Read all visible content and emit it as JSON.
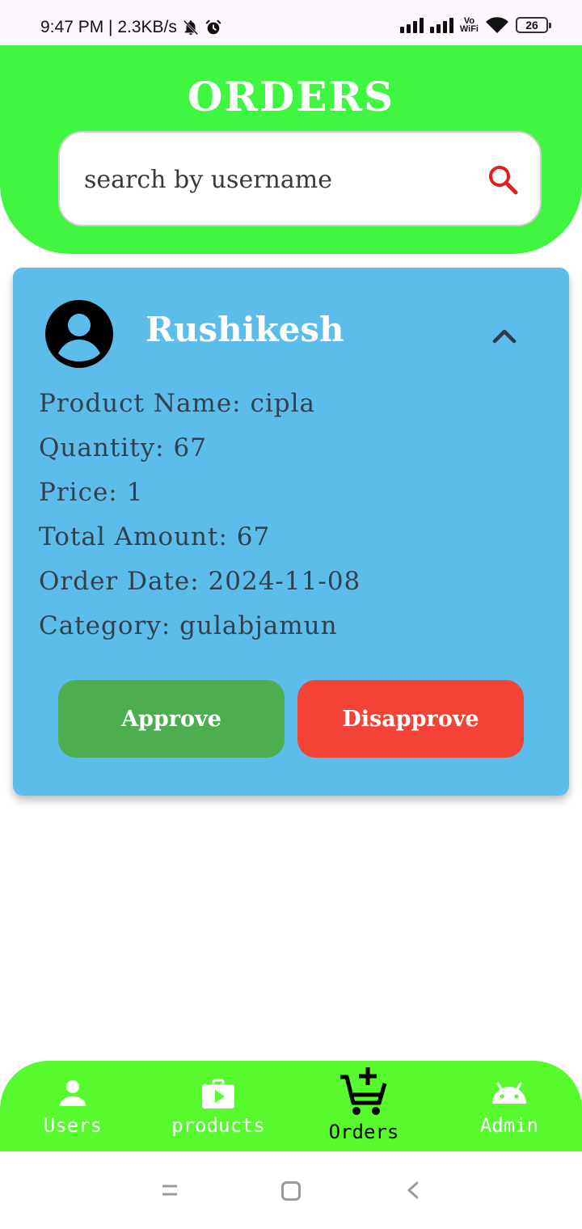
{
  "status_bar": {
    "time_network": "9:47 PM | 2.3KB/s",
    "vowifi_top": "Vo",
    "vowifi_bottom": "WiFi",
    "battery": "26"
  },
  "header": {
    "title": "ORDERS",
    "search_placeholder": "search by username"
  },
  "order": {
    "username": "Rushikesh",
    "details": [
      "Product Name: cipla",
      "Quantity: 67",
      "Price: 1",
      "Total Amount: 67",
      "Order Date: 2024-11-08",
      "Category: gulabjamun"
    ],
    "approve_label": "Approve",
    "disapprove_label": "Disapprove"
  },
  "bottom_nav": {
    "items": [
      {
        "label": "Users",
        "icon": "person-icon"
      },
      {
        "label": "products",
        "icon": "shopping-bag-play-icon"
      },
      {
        "label": "Orders",
        "icon": "cart-add-icon",
        "active": true
      },
      {
        "label": "Admin",
        "icon": "android-icon"
      }
    ]
  },
  "colors": {
    "header_green": "#41f43f",
    "nav_green": "#57fa2c",
    "card_blue": "#5cbdeb",
    "approve_green": "#4cae4f",
    "disapprove_red": "#f44336",
    "search_icon_red": "#e0201c"
  }
}
